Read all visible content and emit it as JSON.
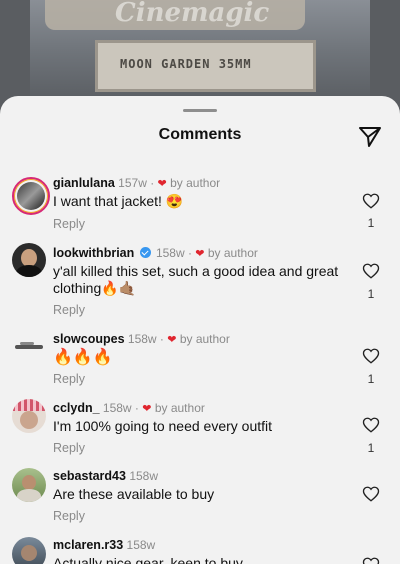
{
  "background": {
    "marquee_text": "Cinemagic",
    "sign_text": "MOON GARDEN  35MM"
  },
  "sheet": {
    "title": "Comments"
  },
  "comments": [
    {
      "username": "gianlulana",
      "time": "157w",
      "liked_by": "by author",
      "text": "I want that jacket! 😍",
      "reply": "Reply",
      "likes": "1",
      "verified": false
    },
    {
      "username": "lookwithbrian",
      "time": "158w",
      "liked_by": "by author",
      "text": "y'all killed this set, such a good idea and great clothing🔥🤙🏽",
      "reply": "Reply",
      "likes": "1",
      "verified": true
    },
    {
      "username": "slowcoupes",
      "time": "158w",
      "liked_by": "by author",
      "text": "🔥🔥🔥",
      "reply": "Reply",
      "likes": "1",
      "verified": false
    },
    {
      "username": "cclydn_",
      "time": "158w",
      "liked_by": "by author",
      "text": "I'm 100% going to need every outfit",
      "reply": "Reply",
      "likes": "1",
      "verified": false
    },
    {
      "username": "sebastard43",
      "time": "158w",
      "liked_by": "",
      "text": "Are these available to buy",
      "reply": "Reply",
      "likes": "",
      "verified": false
    },
    {
      "username": "mclaren.r33",
      "time": "158w",
      "liked_by": "",
      "text": "Actually nice gear, keen to buy",
      "reply": "",
      "likes": "",
      "verified": false
    }
  ],
  "icons": {
    "send": "send-icon",
    "like": "heart-outline-icon",
    "author_like": "heart-filled-icon"
  }
}
